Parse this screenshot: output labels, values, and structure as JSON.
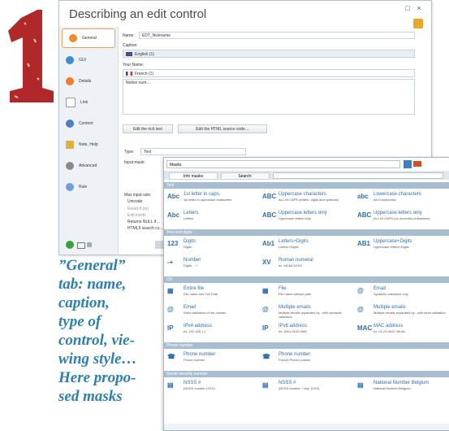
{
  "numeral": "1",
  "caption_lines": [
    "”General”",
    "tab: name,",
    "caption,",
    "type of",
    "control, vie-",
    "wing style…",
    "Here propo-",
    "sed masks"
  ],
  "window": {
    "title": "Describing an edit control",
    "controls": [
      "□",
      "×"
    ],
    "sidebar": [
      "General",
      "GUI",
      "Details",
      "Link",
      "Content",
      "Note, Help",
      "Advanced",
      "Rule"
    ],
    "name_label": "Name:",
    "name_value": "EDT_Nickname",
    "caption_label": "Caption:",
    "caption_lang": "English (1)",
    "yourname_label": "Your Name:",
    "french_lang": "French (1)",
    "noarea_label": "Notice num…",
    "btn_rich": "Edit the rich text",
    "btn_html": "Edit the HTML source code…",
    "type_label": "Type:",
    "type_value": "Text",
    "input_mask_label": "Input mask:",
    "maxlen_label": "Max input size:",
    "unicode_label": "Unicode",
    "opt1": "Reset if (re)",
    "opt2": "Edit inside",
    "opt3": "Returns NULL if…",
    "opt4": "HTML5 search co…"
  },
  "popup": {
    "search_value": "Masks",
    "tabs": [
      "Info masks",
      "Search:"
    ],
    "categories": [
      {
        "name": "Text",
        "items": [
          {
            "icon": "Abc",
            "title": "1st letter in caps.",
            "sub": "1st letter in uppercase characters"
          },
          {
            "icon": "ABC",
            "title": "Uppercase characters",
            "sub": "ALL IN CAPS (letters, digits and symbols)"
          },
          {
            "icon": "abc",
            "title": "Lowercase characters",
            "sub": "All in lowercase"
          },
          {
            "icon": "Abc",
            "title": "Letters",
            "sub": "Letters"
          },
          {
            "icon": "ABC",
            "title": "Uppercase letters only",
            "sub": "Uppercase letters only"
          },
          {
            "icon": "ABC",
            "title": "Uppercase letters only",
            "sub": "ALL IN CAPS (no accented characters)"
          }
        ]
      },
      {
        "name": "Text and digits",
        "items": [
          {
            "icon": "123",
            "title": "Digits",
            "sub": "Digits"
          },
          {
            "icon": "Ab1",
            "title": "Letters+Digits",
            "sub": "Letters+Digits"
          },
          {
            "icon": "AB1",
            "title": "Uppercase+Digits",
            "sub": "Uppercase letters+Digits"
          },
          {
            "icon": "-+",
            "title": "Number",
            "sub": "Digits, - + ."
          },
          {
            "icon": "XV",
            "title": "Roman numeral",
            "sub": "ex: MCMLXXXV"
          }
        ]
      },
      {
        "name": "OS",
        "items": [
          {
            "icon": "▦",
            "title": "Entire file",
            "sub": "File name and Full Path"
          },
          {
            "icon": "▦",
            "title": "File",
            "sub": "File name without path"
          },
          {
            "icon": "@",
            "title": "Email",
            "sub": "Syntactic validation only"
          },
          {
            "icon": "@",
            "title": "Email",
            "sub": "Strict validation of the domain"
          },
          {
            "icon": "@",
            "title": "Multiple emails",
            "sub": "Multiple emails separated by ; with syntactic validation"
          },
          {
            "icon": "@",
            "title": "Multiple emails",
            "sub": "Multiple emails separated by ; with strict validation"
          },
          {
            "icon": "IP",
            "title": "IPv4 address",
            "sub": "ex: 192.168.1.1"
          },
          {
            "icon": "IP",
            "title": "IPv6 address",
            "sub": "ex: 2001:0102:0b02"
          },
          {
            "icon": "MAC",
            "title": "MAC address",
            "sub": "ex: 01:23:45:67:89:ab"
          }
        ]
      },
      {
        "name": "Phone number",
        "items": [
          {
            "icon": "☎",
            "title": "Phone number",
            "sub": "Phone number"
          },
          {
            "icon": "☎",
            "title": "Phone number",
            "sub": "French Phone number"
          }
        ]
      },
      {
        "name": "Social security number",
        "items": [
          {
            "icon": "▤",
            "title": "NSSS #",
            "sub": "(NSSS number (XXX)"
          },
          {
            "icon": "▤",
            "title": "NSSS #",
            "sub": "(NSSS number + key, (XXX)"
          },
          {
            "icon": "▤",
            "title": "National Number Belgium",
            "sub": "National Number Belgium"
          }
        ]
      }
    ]
  },
  "colors": {
    "numeral": "#b0282a",
    "caption": "#2d7fb0",
    "accent": "#f0a050",
    "category_bar": "#a9bdd1",
    "item_title": "#2e6fb0"
  }
}
